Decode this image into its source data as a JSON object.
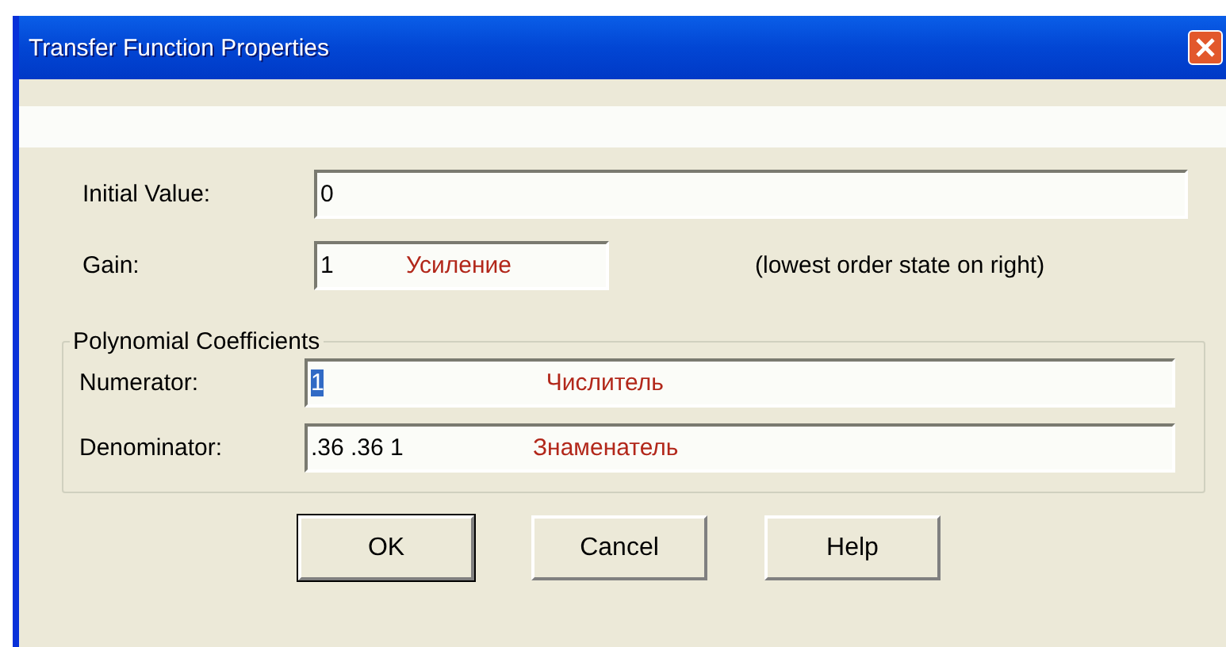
{
  "window": {
    "title": "Transfer Function Properties"
  },
  "fields": [
    {
      "label": "Initial Value:",
      "value": "0",
      "value_selected": false
    },
    {
      "label": "Gain:",
      "value": "1",
      "value_selected": false,
      "annotation": "Усиление",
      "note": "(lowest order state on right)"
    }
  ],
  "group": {
    "title": "Polynomial Coefficients",
    "fields": [
      {
        "label": "Numerator:",
        "value": "1",
        "value_selected": true,
        "annotation": "Числитель"
      },
      {
        "label": "Denominator:",
        "value": ".36 .36 1",
        "value_selected": false,
        "annotation": "Знаменатель"
      }
    ]
  },
  "buttons": [
    {
      "label": "OK",
      "default": true
    },
    {
      "label": "Cancel",
      "default": false
    },
    {
      "label": "Help",
      "default": false
    }
  ]
}
